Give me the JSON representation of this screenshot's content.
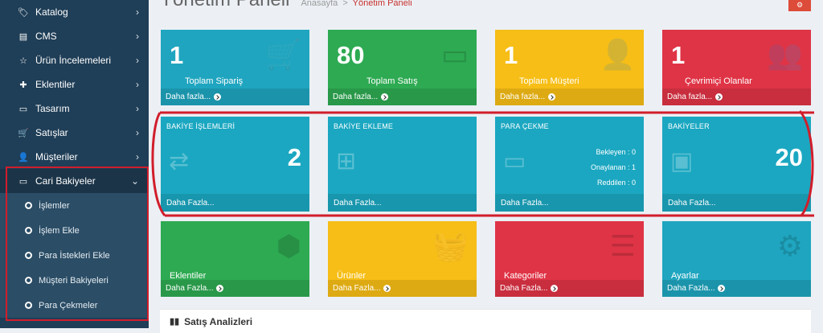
{
  "sidebar": {
    "items": [
      {
        "label": "Katalog",
        "icon": "tag-icon"
      },
      {
        "label": "CMS",
        "icon": "book-icon"
      },
      {
        "label": "Ürün İncelemeleri",
        "icon": "star-icon"
      },
      {
        "label": "Eklentiler",
        "icon": "puzzle-icon"
      },
      {
        "label": "Tasarım",
        "icon": "desktop-icon"
      },
      {
        "label": "Satışlar",
        "icon": "cart-icon"
      },
      {
        "label": "Müşteriler",
        "icon": "user-icon"
      }
    ],
    "active": {
      "label": "Cari Bakiyeler",
      "icon": "credit-card-icon"
    },
    "submenu": [
      "İşlemler",
      "İşlem Ekle",
      "Para İstekleri Ekle",
      "Müşteri Bakiyeleri",
      "Para Çekmeler"
    ]
  },
  "header": {
    "title": "Yönetim Paneli",
    "breadcrumb_home": "Anasayfa",
    "breadcrumb_sep": ">",
    "breadcrumb_current": "Yönetim Paneli"
  },
  "stats": [
    {
      "value": "1",
      "label": "Toplam Sipariş",
      "footer": "Daha fazla...",
      "color": "#1fa5bf"
    },
    {
      "value": "80",
      "label": "Toplam Satış",
      "footer": "Daha fazla...",
      "color": "#2eaa52"
    },
    {
      "value": "1",
      "label": "Toplam Müşteri",
      "footer": "Daha fazla...",
      "color": "#f6be16"
    },
    {
      "value": "1",
      "label": "Çevrimiçi Olanlar",
      "footer": "Daha fazla...",
      "color": "#df3446"
    }
  ],
  "balance": {
    "islemler": {
      "head": "BAKİYE İŞLEMLERİ",
      "value": "2",
      "footer": "Daha Fazla..."
    },
    "ekleme": {
      "head": "BAKİYE EKLEME",
      "footer": "Daha Fazla..."
    },
    "cekme": {
      "head": "PARA ÇEKME",
      "bekleyen": "Bekleyen : 0",
      "onaylanan": "Onaylanan : 1",
      "reddilen": "Reddilen : 0",
      "footer": "Daha Fazla..."
    },
    "bakiyeler": {
      "head": "BAKİYELER",
      "value": "20",
      "footer": "Daha Fazla..."
    }
  },
  "shortcuts": [
    {
      "label": "Eklentiler",
      "footer": "Daha Fazla...",
      "color": "#2eaa52"
    },
    {
      "label": "Ürünler",
      "footer": "Daha Fazla...",
      "color": "#f6be16"
    },
    {
      "label": "Kategoriler",
      "footer": "Daha Fazla...",
      "color": "#df3446"
    },
    {
      "label": "Ayarlar",
      "footer": "Daha Fazla...",
      "color": "#1fa5bf"
    }
  ],
  "analytics": {
    "title": "Satış Analizleri"
  },
  "colors": {
    "annotation": "#d11d2b",
    "sidebar": "#1f3e57"
  }
}
